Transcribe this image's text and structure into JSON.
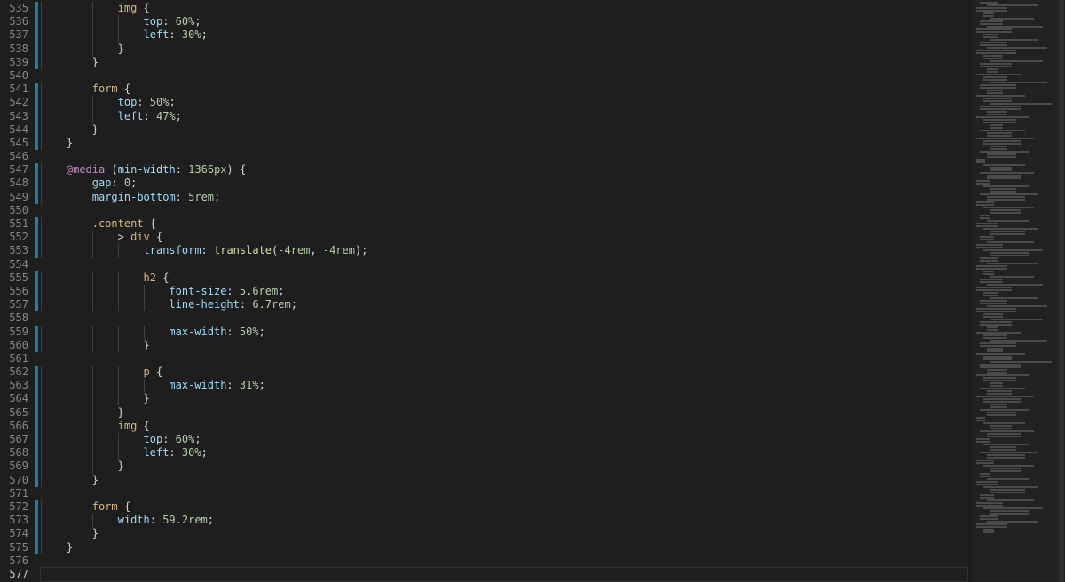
{
  "editor": {
    "current_line": "577",
    "lines": [
      {
        "no": "535",
        "mod": true,
        "indent": 3,
        "segs": [
          [
            "img",
            "t-sel"
          ],
          [
            " {",
            "t-punc"
          ]
        ]
      },
      {
        "no": "536",
        "mod": true,
        "indent": 4,
        "segs": [
          [
            "top",
            "t-prop"
          ],
          [
            ": ",
            "t-punc"
          ],
          [
            "60%",
            "t-num"
          ],
          [
            ";",
            "t-punc"
          ]
        ]
      },
      {
        "no": "537",
        "mod": true,
        "indent": 4,
        "segs": [
          [
            "left",
            "t-prop"
          ],
          [
            ": ",
            "t-punc"
          ],
          [
            "30%",
            "t-num"
          ],
          [
            ";",
            "t-punc"
          ]
        ]
      },
      {
        "no": "538",
        "mod": true,
        "indent": 3,
        "segs": [
          [
            "}",
            "t-punc"
          ]
        ]
      },
      {
        "no": "539",
        "mod": true,
        "indent": 2,
        "segs": [
          [
            "}",
            "t-punc"
          ]
        ]
      },
      {
        "no": "540",
        "mod": false,
        "indent": 0,
        "segs": []
      },
      {
        "no": "541",
        "mod": true,
        "indent": 2,
        "segs": [
          [
            "form",
            "t-sel"
          ],
          [
            " {",
            "t-punc"
          ]
        ]
      },
      {
        "no": "542",
        "mod": true,
        "indent": 3,
        "segs": [
          [
            "top",
            "t-prop"
          ],
          [
            ": ",
            "t-punc"
          ],
          [
            "50%",
            "t-num"
          ],
          [
            ";",
            "t-punc"
          ]
        ]
      },
      {
        "no": "543",
        "mod": true,
        "indent": 3,
        "segs": [
          [
            "left",
            "t-prop"
          ],
          [
            ": ",
            "t-punc"
          ],
          [
            "47%",
            "t-num"
          ],
          [
            ";",
            "t-punc"
          ]
        ]
      },
      {
        "no": "544",
        "mod": true,
        "indent": 2,
        "segs": [
          [
            "}",
            "t-punc"
          ]
        ]
      },
      {
        "no": "545",
        "mod": true,
        "indent": 1,
        "segs": [
          [
            "}",
            "t-punc"
          ]
        ]
      },
      {
        "no": "546",
        "mod": false,
        "indent": 0,
        "segs": []
      },
      {
        "no": "547",
        "mod": true,
        "indent": 1,
        "segs": [
          [
            "@media",
            "t-key"
          ],
          [
            " (",
            "t-punc"
          ],
          [
            "min-width",
            "t-prop"
          ],
          [
            ": ",
            "t-punc"
          ],
          [
            "1366px",
            "t-num"
          ],
          [
            ") {",
            "t-punc"
          ]
        ]
      },
      {
        "no": "548",
        "mod": true,
        "indent": 2,
        "segs": [
          [
            "gap",
            "t-prop"
          ],
          [
            ": ",
            "t-punc"
          ],
          [
            "0",
            "t-num"
          ],
          [
            ";",
            "t-punc"
          ]
        ]
      },
      {
        "no": "549",
        "mod": true,
        "indent": 2,
        "segs": [
          [
            "margin-bottom",
            "t-prop"
          ],
          [
            ": ",
            "t-punc"
          ],
          [
            "5rem",
            "t-num"
          ],
          [
            ";",
            "t-punc"
          ]
        ]
      },
      {
        "no": "550",
        "mod": false,
        "indent": 0,
        "segs": []
      },
      {
        "no": "551",
        "mod": true,
        "indent": 2,
        "segs": [
          [
            ".content",
            "t-sel"
          ],
          [
            " {",
            "t-punc"
          ]
        ]
      },
      {
        "no": "552",
        "mod": true,
        "indent": 3,
        "segs": [
          [
            "> ",
            "t-punc"
          ],
          [
            "div",
            "t-sel"
          ],
          [
            " {",
            "t-punc"
          ]
        ]
      },
      {
        "no": "553",
        "mod": true,
        "indent": 4,
        "segs": [
          [
            "transform",
            "t-prop"
          ],
          [
            ": ",
            "t-punc"
          ],
          [
            "translate",
            "t-fn"
          ],
          [
            "(",
            "t-punc"
          ],
          [
            "-4rem",
            "t-num"
          ],
          [
            ", ",
            "t-punc"
          ],
          [
            "-4rem",
            "t-num"
          ],
          [
            ");",
            "t-punc"
          ]
        ]
      },
      {
        "no": "554",
        "mod": false,
        "indent": 0,
        "segs": []
      },
      {
        "no": "555",
        "mod": true,
        "indent": 4,
        "segs": [
          [
            "h2",
            "t-sel"
          ],
          [
            " {",
            "t-punc"
          ]
        ]
      },
      {
        "no": "556",
        "mod": true,
        "indent": 5,
        "segs": [
          [
            "font-size",
            "t-prop"
          ],
          [
            ": ",
            "t-punc"
          ],
          [
            "5.6rem",
            "t-num"
          ],
          [
            ";",
            "t-punc"
          ]
        ]
      },
      {
        "no": "557",
        "mod": true,
        "indent": 5,
        "segs": [
          [
            "line-height",
            "t-prop"
          ],
          [
            ": ",
            "t-punc"
          ],
          [
            "6.7rem",
            "t-num"
          ],
          [
            ";",
            "t-punc"
          ]
        ]
      },
      {
        "no": "558",
        "mod": false,
        "indent": 0,
        "segs": []
      },
      {
        "no": "559",
        "mod": true,
        "indent": 5,
        "segs": [
          [
            "max-width",
            "t-prop"
          ],
          [
            ": ",
            "t-punc"
          ],
          [
            "50%",
            "t-num"
          ],
          [
            ";",
            "t-punc"
          ]
        ]
      },
      {
        "no": "560",
        "mod": true,
        "indent": 4,
        "segs": [
          [
            "}",
            "t-punc"
          ]
        ]
      },
      {
        "no": "561",
        "mod": false,
        "indent": 0,
        "segs": []
      },
      {
        "no": "562",
        "mod": true,
        "indent": 4,
        "segs": [
          [
            "p",
            "t-sel"
          ],
          [
            " {",
            "t-punc"
          ]
        ]
      },
      {
        "no": "563",
        "mod": true,
        "indent": 5,
        "segs": [
          [
            "max-width",
            "t-prop"
          ],
          [
            ": ",
            "t-punc"
          ],
          [
            "31%",
            "t-num"
          ],
          [
            ";",
            "t-punc"
          ]
        ]
      },
      {
        "no": "564",
        "mod": true,
        "indent": 4,
        "segs": [
          [
            "}",
            "t-punc"
          ]
        ]
      },
      {
        "no": "565",
        "mod": true,
        "indent": 3,
        "segs": [
          [
            "}",
            "t-punc"
          ]
        ]
      },
      {
        "no": "566",
        "mod": true,
        "indent": 3,
        "segs": [
          [
            "img",
            "t-sel"
          ],
          [
            " {",
            "t-punc"
          ]
        ]
      },
      {
        "no": "567",
        "mod": true,
        "indent": 4,
        "segs": [
          [
            "top",
            "t-prop"
          ],
          [
            ": ",
            "t-punc"
          ],
          [
            "60%",
            "t-num"
          ],
          [
            ";",
            "t-punc"
          ]
        ]
      },
      {
        "no": "568",
        "mod": true,
        "indent": 4,
        "segs": [
          [
            "left",
            "t-prop"
          ],
          [
            ": ",
            "t-punc"
          ],
          [
            "30%",
            "t-num"
          ],
          [
            ";",
            "t-punc"
          ]
        ]
      },
      {
        "no": "569",
        "mod": true,
        "indent": 3,
        "segs": [
          [
            "}",
            "t-punc"
          ]
        ]
      },
      {
        "no": "570",
        "mod": true,
        "indent": 2,
        "segs": [
          [
            "}",
            "t-punc"
          ]
        ]
      },
      {
        "no": "571",
        "mod": false,
        "indent": 0,
        "segs": []
      },
      {
        "no": "572",
        "mod": true,
        "indent": 2,
        "segs": [
          [
            "form",
            "t-sel"
          ],
          [
            " {",
            "t-punc"
          ]
        ]
      },
      {
        "no": "573",
        "mod": true,
        "indent": 3,
        "segs": [
          [
            "width",
            "t-prop"
          ],
          [
            ": ",
            "t-punc"
          ],
          [
            "59.2rem",
            "t-num"
          ],
          [
            ";",
            "t-punc"
          ]
        ]
      },
      {
        "no": "574",
        "mod": true,
        "indent": 2,
        "segs": [
          [
            "}",
            "t-punc"
          ]
        ]
      },
      {
        "no": "575",
        "mod": true,
        "indent": 1,
        "segs": [
          [
            "}",
            "t-punc"
          ]
        ]
      },
      {
        "no": "576",
        "mod": false,
        "indent": 0,
        "segs": []
      },
      {
        "no": "577",
        "mod": false,
        "indent": 0,
        "segs": []
      }
    ]
  },
  "colors": {
    "background": "#1e1e1e",
    "selector": "#d7ba7d",
    "property": "#9cdcfe",
    "number": "#b5cea8",
    "keyword": "#c586c0",
    "function": "#dcdcaa",
    "modified_bar": "#1b81a8"
  }
}
